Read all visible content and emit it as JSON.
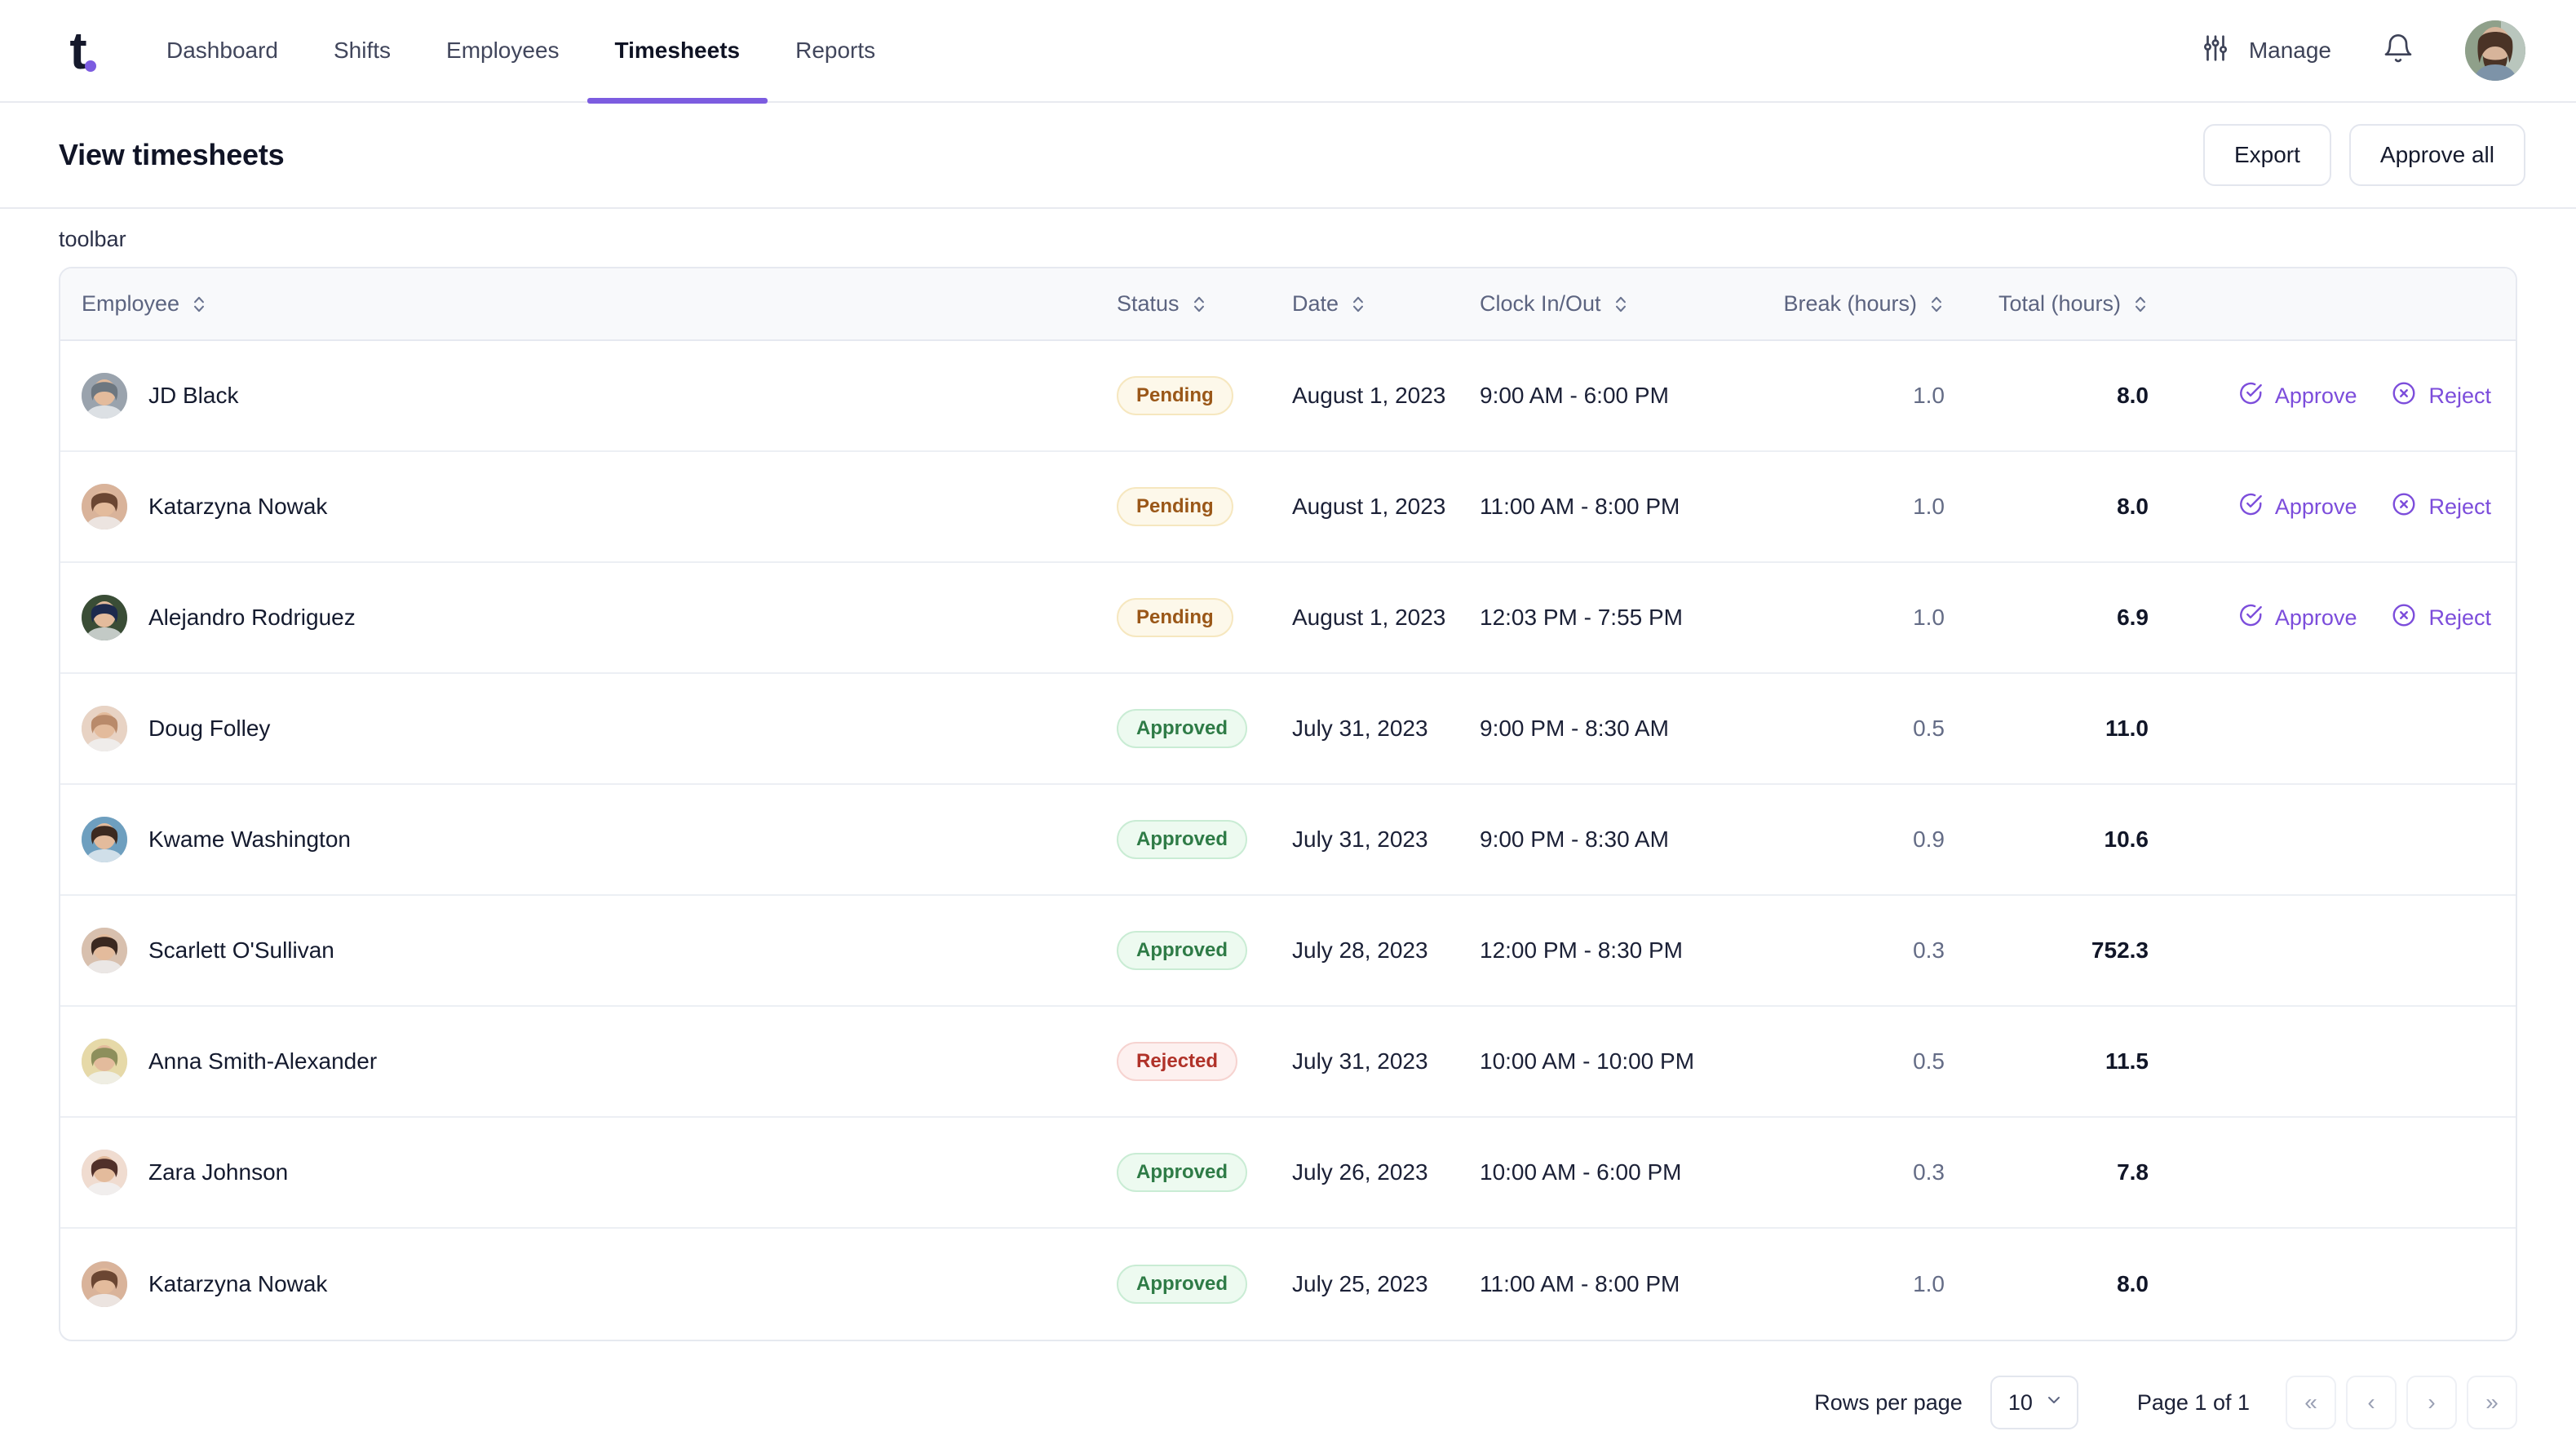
{
  "nav": {
    "logo_letter": "t",
    "items": [
      {
        "label": "Dashboard",
        "active": false
      },
      {
        "label": "Shifts",
        "active": false
      },
      {
        "label": "Employees",
        "active": false
      },
      {
        "label": "Timesheets",
        "active": true
      },
      {
        "label": "Reports",
        "active": false
      }
    ],
    "manage_label": "Manage",
    "icons": {
      "manage": "sliders-icon",
      "notifications": "bell-icon",
      "avatar": "user-avatar"
    }
  },
  "header": {
    "title": "View timesheets",
    "export_label": "Export",
    "approve_all_label": "Approve all"
  },
  "toolbar": {
    "label": "toolbar"
  },
  "table": {
    "columns": [
      {
        "label": "Employee",
        "align": "left",
        "sortable": true
      },
      {
        "label": "Status",
        "align": "left",
        "sortable": true
      },
      {
        "label": "Date",
        "align": "left",
        "sortable": true
      },
      {
        "label": "Clock In/Out",
        "align": "left",
        "sortable": true
      },
      {
        "label": "Break (hours)",
        "align": "right",
        "sortable": true
      },
      {
        "label": "Total (hours)",
        "align": "right",
        "sortable": true
      },
      {
        "label": "",
        "align": "right",
        "sortable": false
      }
    ],
    "actions": {
      "approve_label": "Approve",
      "reject_label": "Reject"
    },
    "rows": [
      {
        "employee": "JD Black",
        "status": "Pending",
        "status_kind": "pending",
        "date": "August 1, 2023",
        "clock": "9:00 AM - 6:00 PM",
        "break": "1.0",
        "total": "8.0",
        "has_actions": true,
        "avatar_colors": [
          "#9aa3ad",
          "#6d7780"
        ]
      },
      {
        "employee": "Katarzyna Nowak",
        "status": "Pending",
        "status_kind": "pending",
        "date": "August 1, 2023",
        "clock": "11:00 AM - 8:00 PM",
        "break": "1.0",
        "total": "8.0",
        "has_actions": true,
        "avatar_colors": [
          "#d9b39a",
          "#6b4632"
        ]
      },
      {
        "employee": "Alejandro Rodriguez",
        "status": "Pending",
        "status_kind": "pending",
        "date": "August 1, 2023",
        "clock": "12:03 PM - 7:55 PM",
        "break": "1.0",
        "total": "6.9",
        "has_actions": true,
        "avatar_colors": [
          "#3a4d36",
          "#1d2a4d"
        ]
      },
      {
        "employee": "Doug Folley",
        "status": "Approved",
        "status_kind": "approved",
        "date": "July 31, 2023",
        "clock": "9:00 PM - 8:30 AM",
        "break": "0.5",
        "total": "11.0",
        "has_actions": false,
        "avatar_colors": [
          "#e8d3c4",
          "#b98a6a"
        ]
      },
      {
        "employee": "Kwame Washington",
        "status": "Approved",
        "status_kind": "approved",
        "date": "July 31, 2023",
        "clock": "9:00 PM - 8:30 AM",
        "break": "0.9",
        "total": "10.6",
        "has_actions": false,
        "avatar_colors": [
          "#6e9fbf",
          "#3c2a20"
        ]
      },
      {
        "employee": "Scarlett O'Sullivan",
        "status": "Approved",
        "status_kind": "approved",
        "date": "July 28, 2023",
        "clock": "12:00 PM - 8:30 PM",
        "break": "0.3",
        "total": "752.3",
        "has_actions": false,
        "avatar_colors": [
          "#d8c0ae",
          "#3a2820"
        ]
      },
      {
        "employee": "Anna Smith-Alexander",
        "status": "Rejected",
        "status_kind": "rejected",
        "date": "July 31, 2023",
        "clock": "10:00 AM - 10:00 PM",
        "break": "0.5",
        "total": "11.5",
        "has_actions": false,
        "avatar_colors": [
          "#e6d9a8",
          "#8d8f5c"
        ]
      },
      {
        "employee": "Zara Johnson",
        "status": "Approved",
        "status_kind": "approved",
        "date": "July 26, 2023",
        "clock": "10:00 AM - 6:00 PM",
        "break": "0.3",
        "total": "7.8",
        "has_actions": false,
        "avatar_colors": [
          "#f0dcd0",
          "#50302a"
        ]
      },
      {
        "employee": "Katarzyna Nowak",
        "status": "Approved",
        "status_kind": "approved",
        "date": "July 25, 2023",
        "clock": "11:00 AM - 8:00 PM",
        "break": "1.0",
        "total": "8.0",
        "has_actions": false,
        "avatar_colors": [
          "#d9b39a",
          "#6b4632"
        ]
      }
    ]
  },
  "pagination": {
    "rows_per_page_label": "Rows per page",
    "rows_per_page_value": "10",
    "page_info": "Page 1 of 1",
    "first_label": "«",
    "prev_label": "‹",
    "next_label": "›",
    "last_label": "»"
  },
  "colors": {
    "accent": "#7c5ce0",
    "link": "#7c4ddb",
    "pending_bg": "#fdf8ea",
    "pending_fg": "#9a5718",
    "approved_bg": "#edfaf0",
    "approved_fg": "#2e7b46",
    "rejected_bg": "#fdf0ef",
    "rejected_fg": "#b03229"
  }
}
